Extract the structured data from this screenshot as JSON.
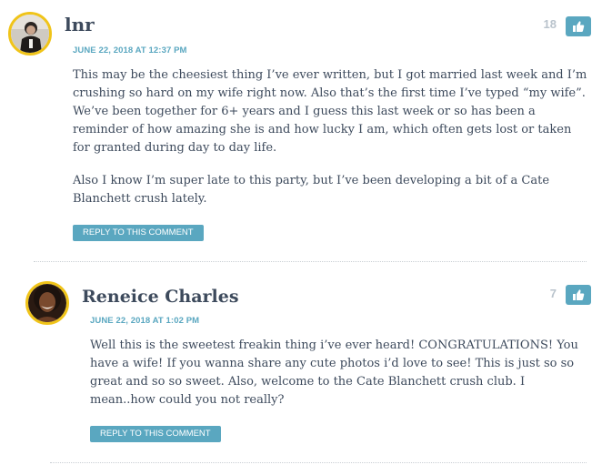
{
  "comments": [
    {
      "author": "lnr",
      "date": "JUNE 22, 2018 AT 12:37 PM",
      "votes": "18",
      "paragraphs": [
        "This may be the cheesiest thing I’ve ever written, but I got married last week and I’m crushing so hard on my wife right now. Also that’s the first time I’ve typed “my wife”. We’ve been together for 6+ years and I guess this last week or so has been a reminder of how amazing she is and how lucky I am, which often gets lost or taken for granted during day to day life.",
        "Also I know I’m super late to this party, but I’ve been developing a bit of a Cate Blanchett crush lately."
      ],
      "reply_label": "REPLY TO THIS COMMENT"
    },
    {
      "author": "Reneice Charles",
      "date": "JUNE 22, 2018 AT 1:02 PM",
      "votes": "7",
      "paragraphs": [
        "Well this is the sweetest freakin thing i’ve ever heard! CONGRATULATIONS! You have a wife! If you wanna share any cute photos i’d love to see! This is just so so great and so so sweet. Also, welcome to the Cate Blanchett crush club. I mean..how could you not really?"
      ],
      "reply_label": "REPLY TO THIS COMMENT"
    }
  ],
  "icons": {
    "vote": "thumbs-up-icon"
  },
  "colors": {
    "accent": "#5aa7c0",
    "avatar_ring": "#f0c419",
    "text": "#3d4a5c",
    "vote_count": "#b9c3cc"
  }
}
